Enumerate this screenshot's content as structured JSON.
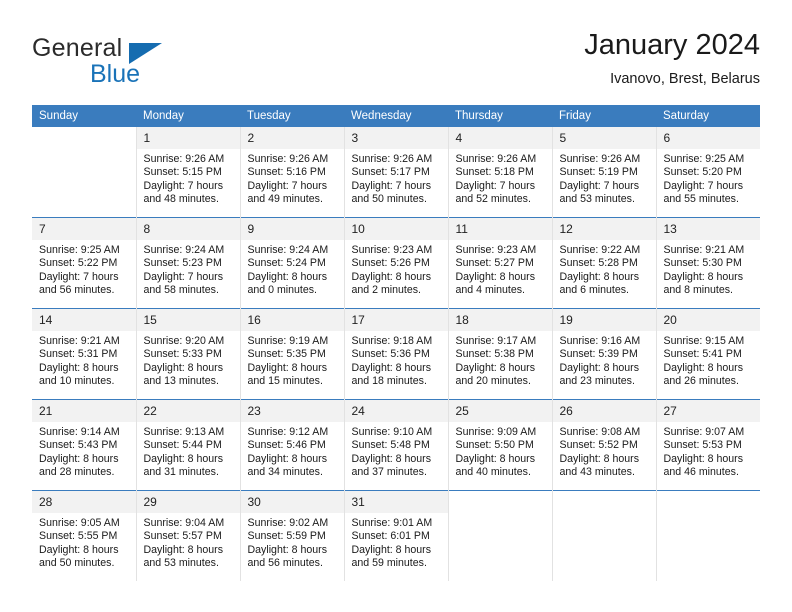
{
  "brand": {
    "name_part1": "General",
    "name_part2": "Blue",
    "accent_color": "#156cb0"
  },
  "header": {
    "title": "January 2024",
    "subtitle": "Ivanovo, Brest, Belarus"
  },
  "calendar": {
    "header_color": "#3a7cbe",
    "weekday_headers": [
      "Sunday",
      "Monday",
      "Tuesday",
      "Wednesday",
      "Thursday",
      "Friday",
      "Saturday"
    ],
    "weeks": [
      [
        {
          "day": "",
          "lines": []
        },
        {
          "day": "1",
          "lines": [
            "Sunrise: 9:26 AM",
            "Sunset: 5:15 PM",
            "Daylight: 7 hours",
            "and 48 minutes."
          ]
        },
        {
          "day": "2",
          "lines": [
            "Sunrise: 9:26 AM",
            "Sunset: 5:16 PM",
            "Daylight: 7 hours",
            "and 49 minutes."
          ]
        },
        {
          "day": "3",
          "lines": [
            "Sunrise: 9:26 AM",
            "Sunset: 5:17 PM",
            "Daylight: 7 hours",
            "and 50 minutes."
          ]
        },
        {
          "day": "4",
          "lines": [
            "Sunrise: 9:26 AM",
            "Sunset: 5:18 PM",
            "Daylight: 7 hours",
            "and 52 minutes."
          ]
        },
        {
          "day": "5",
          "lines": [
            "Sunrise: 9:26 AM",
            "Sunset: 5:19 PM",
            "Daylight: 7 hours",
            "and 53 minutes."
          ]
        },
        {
          "day": "6",
          "lines": [
            "Sunrise: 9:25 AM",
            "Sunset: 5:20 PM",
            "Daylight: 7 hours",
            "and 55 minutes."
          ]
        }
      ],
      [
        {
          "day": "7",
          "lines": [
            "Sunrise: 9:25 AM",
            "Sunset: 5:22 PM",
            "Daylight: 7 hours",
            "and 56 minutes."
          ]
        },
        {
          "day": "8",
          "lines": [
            "Sunrise: 9:24 AM",
            "Sunset: 5:23 PM",
            "Daylight: 7 hours",
            "and 58 minutes."
          ]
        },
        {
          "day": "9",
          "lines": [
            "Sunrise: 9:24 AM",
            "Sunset: 5:24 PM",
            "Daylight: 8 hours",
            "and 0 minutes."
          ]
        },
        {
          "day": "10",
          "lines": [
            "Sunrise: 9:23 AM",
            "Sunset: 5:26 PM",
            "Daylight: 8 hours",
            "and 2 minutes."
          ]
        },
        {
          "day": "11",
          "lines": [
            "Sunrise: 9:23 AM",
            "Sunset: 5:27 PM",
            "Daylight: 8 hours",
            "and 4 minutes."
          ]
        },
        {
          "day": "12",
          "lines": [
            "Sunrise: 9:22 AM",
            "Sunset: 5:28 PM",
            "Daylight: 8 hours",
            "and 6 minutes."
          ]
        },
        {
          "day": "13",
          "lines": [
            "Sunrise: 9:21 AM",
            "Sunset: 5:30 PM",
            "Daylight: 8 hours",
            "and 8 minutes."
          ]
        }
      ],
      [
        {
          "day": "14",
          "lines": [
            "Sunrise: 9:21 AM",
            "Sunset: 5:31 PM",
            "Daylight: 8 hours",
            "and 10 minutes."
          ]
        },
        {
          "day": "15",
          "lines": [
            "Sunrise: 9:20 AM",
            "Sunset: 5:33 PM",
            "Daylight: 8 hours",
            "and 13 minutes."
          ]
        },
        {
          "day": "16",
          "lines": [
            "Sunrise: 9:19 AM",
            "Sunset: 5:35 PM",
            "Daylight: 8 hours",
            "and 15 minutes."
          ]
        },
        {
          "day": "17",
          "lines": [
            "Sunrise: 9:18 AM",
            "Sunset: 5:36 PM",
            "Daylight: 8 hours",
            "and 18 minutes."
          ]
        },
        {
          "day": "18",
          "lines": [
            "Sunrise: 9:17 AM",
            "Sunset: 5:38 PM",
            "Daylight: 8 hours",
            "and 20 minutes."
          ]
        },
        {
          "day": "19",
          "lines": [
            "Sunrise: 9:16 AM",
            "Sunset: 5:39 PM",
            "Daylight: 8 hours",
            "and 23 minutes."
          ]
        },
        {
          "day": "20",
          "lines": [
            "Sunrise: 9:15 AM",
            "Sunset: 5:41 PM",
            "Daylight: 8 hours",
            "and 26 minutes."
          ]
        }
      ],
      [
        {
          "day": "21",
          "lines": [
            "Sunrise: 9:14 AM",
            "Sunset: 5:43 PM",
            "Daylight: 8 hours",
            "and 28 minutes."
          ]
        },
        {
          "day": "22",
          "lines": [
            "Sunrise: 9:13 AM",
            "Sunset: 5:44 PM",
            "Daylight: 8 hours",
            "and 31 minutes."
          ]
        },
        {
          "day": "23",
          "lines": [
            "Sunrise: 9:12 AM",
            "Sunset: 5:46 PM",
            "Daylight: 8 hours",
            "and 34 minutes."
          ]
        },
        {
          "day": "24",
          "lines": [
            "Sunrise: 9:10 AM",
            "Sunset: 5:48 PM",
            "Daylight: 8 hours",
            "and 37 minutes."
          ]
        },
        {
          "day": "25",
          "lines": [
            "Sunrise: 9:09 AM",
            "Sunset: 5:50 PM",
            "Daylight: 8 hours",
            "and 40 minutes."
          ]
        },
        {
          "day": "26",
          "lines": [
            "Sunrise: 9:08 AM",
            "Sunset: 5:52 PM",
            "Daylight: 8 hours",
            "and 43 minutes."
          ]
        },
        {
          "day": "27",
          "lines": [
            "Sunrise: 9:07 AM",
            "Sunset: 5:53 PM",
            "Daylight: 8 hours",
            "and 46 minutes."
          ]
        }
      ],
      [
        {
          "day": "28",
          "lines": [
            "Sunrise: 9:05 AM",
            "Sunset: 5:55 PM",
            "Daylight: 8 hours",
            "and 50 minutes."
          ]
        },
        {
          "day": "29",
          "lines": [
            "Sunrise: 9:04 AM",
            "Sunset: 5:57 PM",
            "Daylight: 8 hours",
            "and 53 minutes."
          ]
        },
        {
          "day": "30",
          "lines": [
            "Sunrise: 9:02 AM",
            "Sunset: 5:59 PM",
            "Daylight: 8 hours",
            "and 56 minutes."
          ]
        },
        {
          "day": "31",
          "lines": [
            "Sunrise: 9:01 AM",
            "Sunset: 6:01 PM",
            "Daylight: 8 hours",
            "and 59 minutes."
          ]
        },
        {
          "day": "",
          "lines": []
        },
        {
          "day": "",
          "lines": []
        },
        {
          "day": "",
          "lines": []
        }
      ]
    ]
  }
}
